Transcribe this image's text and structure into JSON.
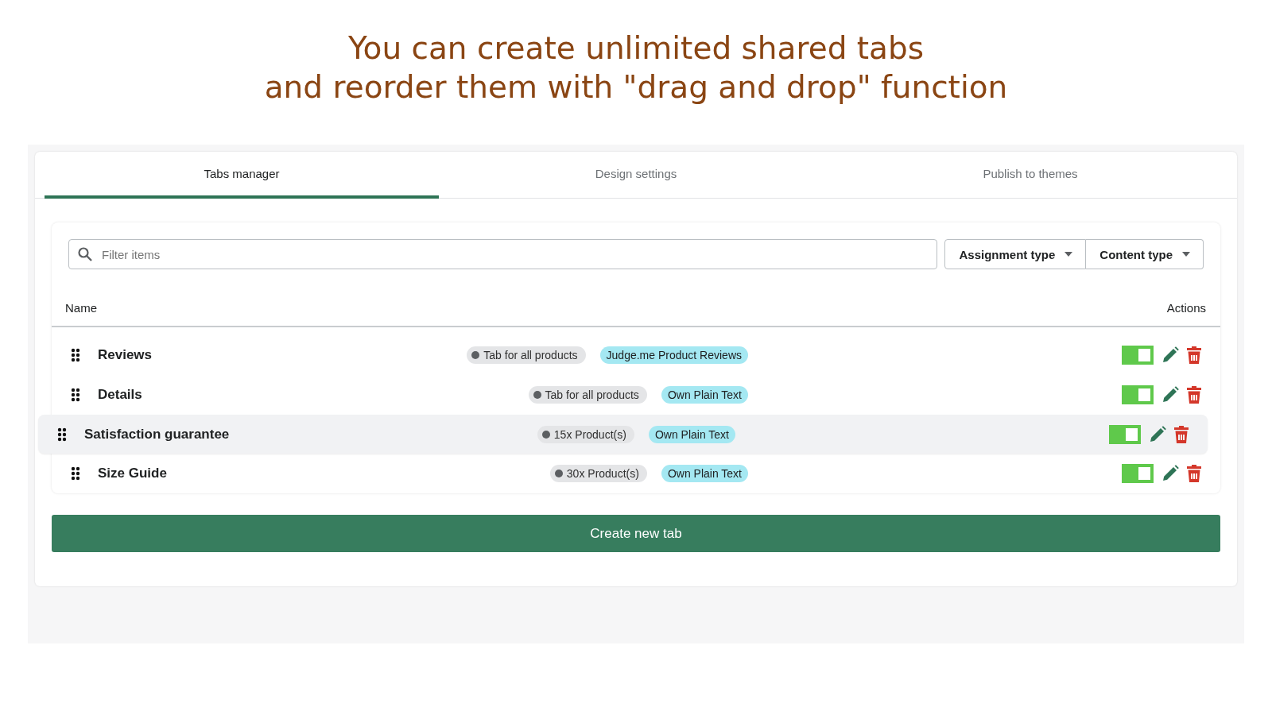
{
  "headline": [
    "You can create unlimited shared tabs",
    "and reorder them with \"drag and drop\" function"
  ],
  "tabs": [
    {
      "label": "Tabs manager",
      "selected": true
    },
    {
      "label": "Design settings",
      "selected": false
    },
    {
      "label": "Publish to themes",
      "selected": false
    }
  ],
  "search": {
    "placeholder": "Filter items"
  },
  "filters": [
    "Assignment type",
    "Content type"
  ],
  "table": {
    "columns": [
      "Name",
      "Actions"
    ],
    "rows": [
      {
        "name": "Reviews",
        "assignment": "Tab for all products",
        "content": "Judge.me Product Reviews",
        "on": true,
        "dragging": false
      },
      {
        "name": "Details",
        "assignment": "Tab for all products",
        "content": "Own Plain Text",
        "on": true,
        "dragging": false
      },
      {
        "name": "Satisfaction guarantee",
        "assignment": "15x Product(s)",
        "content": "Own Plain Text",
        "on": true,
        "dragging": true
      },
      {
        "name": "Size Guide",
        "assignment": "30x Product(s)",
        "content": "Own Plain Text",
        "on": true,
        "dragging": false
      }
    ]
  },
  "create_button": "Create new tab"
}
